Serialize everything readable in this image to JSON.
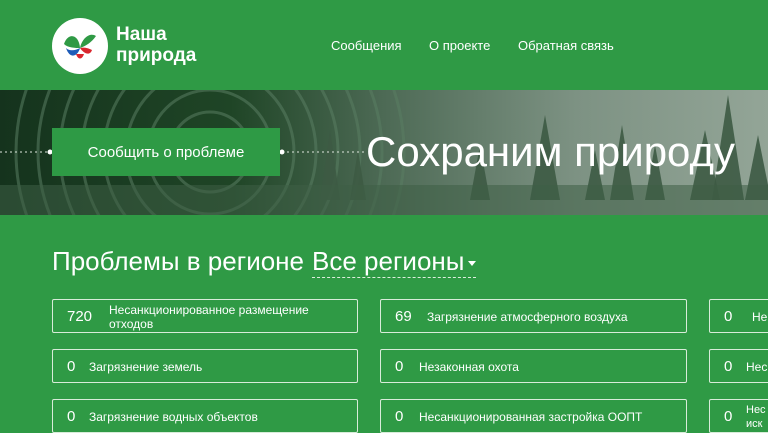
{
  "header": {
    "brand_line1": "Наша",
    "brand_line2": "природа",
    "nav": [
      "Сообщения",
      "О проекте",
      "Обратная связь"
    ]
  },
  "hero": {
    "report_button": "Сообщить о проблеме",
    "title": "Сохраним природу"
  },
  "region": {
    "heading": "Проблемы в регионе",
    "selected": "Все регионы"
  },
  "cards": [
    {
      "count": "720",
      "label": "Несанкционированное размещение отходов"
    },
    {
      "count": "69",
      "label": "Загрязнение атмосферного воздуха"
    },
    {
      "count": "0",
      "label": "Не"
    },
    {
      "count": "0",
      "label": "Загрязнение земель"
    },
    {
      "count": "0",
      "label": "Незаконная охота"
    },
    {
      "count": "0",
      "label": "Нес"
    },
    {
      "count": "0",
      "label": "Загрязнение водных объектов"
    },
    {
      "count": "0",
      "label": "Несанкционированная застройка ООПТ"
    },
    {
      "count": "0",
      "label": "Нес иск"
    }
  ],
  "colors": {
    "brand_green": "#2f9a45",
    "button_green": "#2e9a45"
  }
}
